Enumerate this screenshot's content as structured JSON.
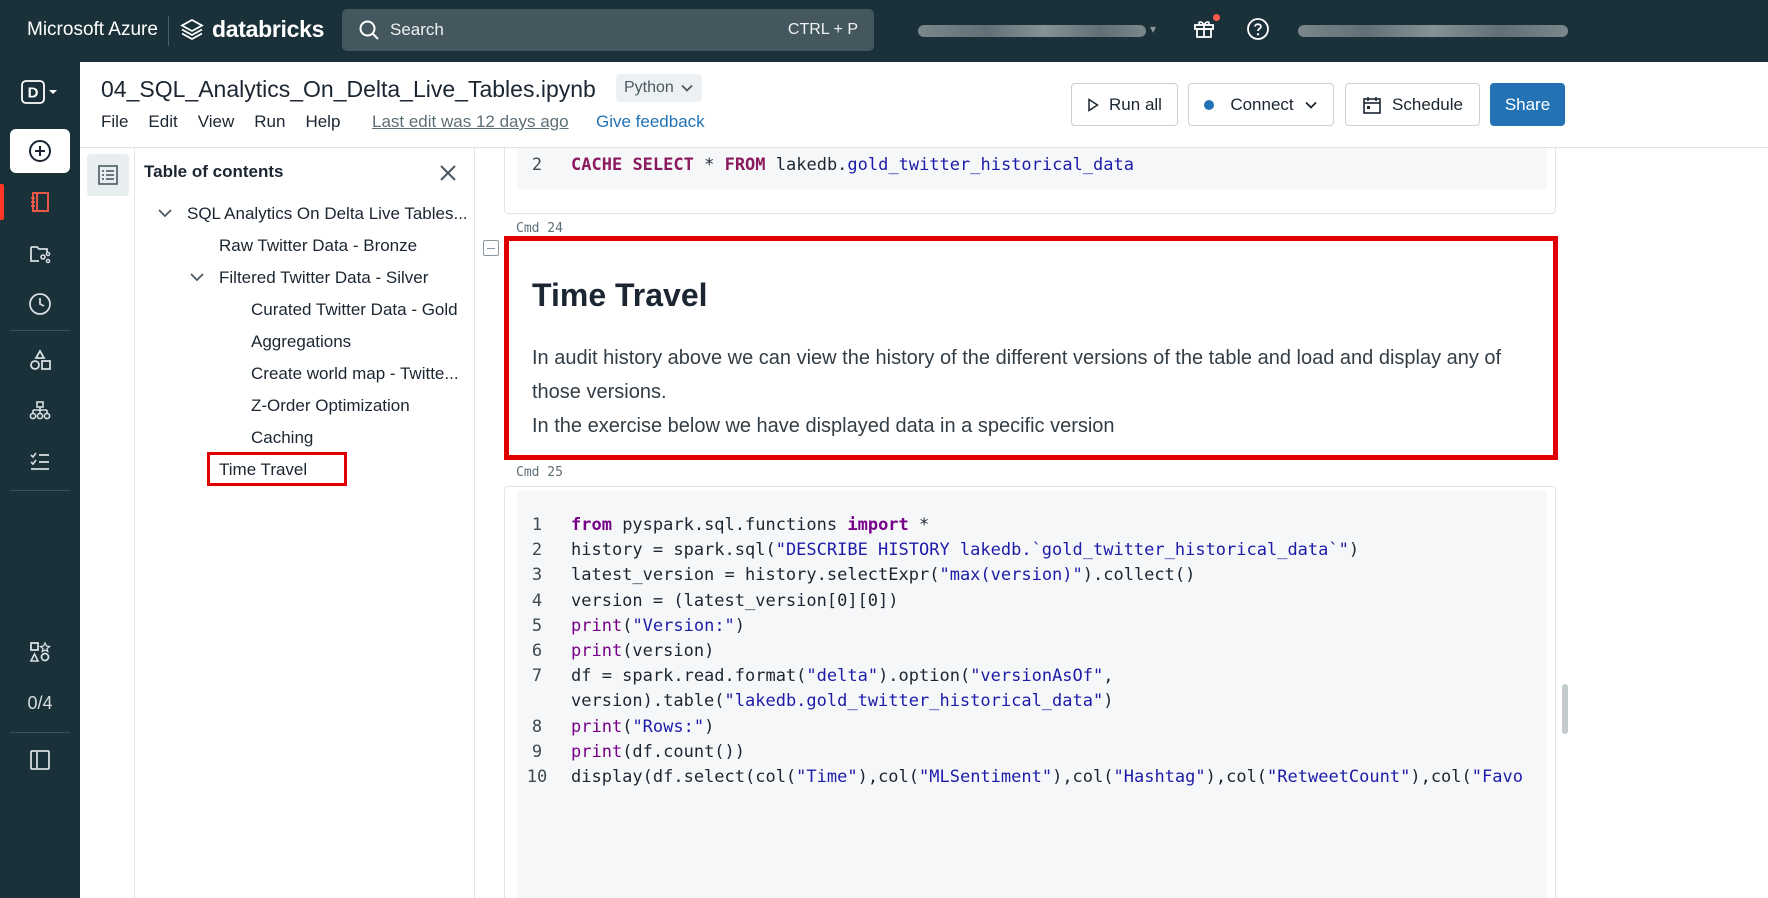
{
  "topbar": {
    "azure_label": "Microsoft Azure",
    "brand_label": "databricks",
    "search_placeholder": "Search",
    "search_shortcut": "CTRL + P"
  },
  "leftnav": {
    "workspace_letter": "D",
    "progress_count": "0/4"
  },
  "notebook": {
    "title": "04_SQL_Analytics_On_Delta_Live_Tables.ipynb",
    "language": "Python",
    "menu": [
      "File",
      "Edit",
      "View",
      "Run",
      "Help"
    ],
    "last_edit": "Last edit was 12 days ago",
    "feedback": "Give feedback",
    "buttons": {
      "run_all": "Run all",
      "connect": "Connect",
      "schedule": "Schedule",
      "share": "Share"
    }
  },
  "toc": {
    "title": "Table of contents",
    "items": [
      {
        "label": "SQL Analytics On Delta Live Tables...",
        "level": 0,
        "expanded": true
      },
      {
        "label": "Raw Twitter Data - Bronze",
        "level": 1
      },
      {
        "label": "Filtered Twitter Data - Silver",
        "level": 1,
        "expanded": true
      },
      {
        "label": "Curated Twitter Data - Gold",
        "level": 2
      },
      {
        "label": "Aggregations",
        "level": 2
      },
      {
        "label": "Create world map - Twitte...",
        "level": 2
      },
      {
        "label": "Z-Order Optimization",
        "level": 2
      },
      {
        "label": "Caching",
        "level": 2
      },
      {
        "label": "Time Travel",
        "level": 1,
        "highlighted": true
      }
    ]
  },
  "cells": {
    "prev": {
      "line_no": "2",
      "code": {
        "kw1": "CACHE",
        "kw2": "SELECT",
        "star": " * ",
        "kw3": "FROM",
        "rest_a": " lakedb.",
        "rest_b": "gold_twitter_historical_data"
      }
    },
    "cmd24": "Cmd 24",
    "markdown": {
      "heading": "Time Travel",
      "para1": "In audit history above we can view the history of the different versions of the table and load and display any of those versions.",
      "para2": "In the exercise below we have displayed data in a specific version"
    },
    "cmd25": "Cmd 25",
    "code_lines": [
      {
        "n": "1"
      },
      {
        "n": "2"
      },
      {
        "n": "3"
      },
      {
        "n": "4"
      },
      {
        "n": "5"
      },
      {
        "n": "6"
      },
      {
        "n": "7"
      },
      {
        "n": ""
      },
      {
        "n": "8"
      },
      {
        "n": "9"
      },
      {
        "n": "10"
      }
    ],
    "code_text": {
      "l1_from": "from",
      "l1_mod": " pyspark.sql.functions ",
      "l1_imp": "import",
      "l1_star": " *",
      "l2_a": "history = spark.sql(",
      "l2_s": "\"DESCRIBE HISTORY lakedb.`gold_twitter_historical_data`\"",
      "l2_b": ")",
      "l3_a": "latest_version = history.selectExpr(",
      "l3_s": "\"max(version)\"",
      "l3_b": ").collect()",
      "l4": "version = (latest_version[0][0])",
      "l5_p": "print",
      "l5_a": "(",
      "l5_s": "\"Version:\"",
      "l5_b": ")",
      "l6_p": "print",
      "l6_a": "(version)",
      "l7_a": "df = spark.read.format(",
      "l7_s1": "\"delta\"",
      "l7_b": ").option(",
      "l7_s2": "\"versionAsOf\"",
      "l7_c": ",",
      "l7w_a": "version).table(",
      "l7w_s": "\"lakedb.gold_twitter_historical_data\"",
      "l7w_b": ")",
      "l8_p": "print",
      "l8_a": "(",
      "l8_s": "\"Rows:\"",
      "l8_b": ")",
      "l9_p": "print",
      "l9_a": "(df.count())",
      "l10_a": "display(df.select(col(",
      "l10_s1": "\"Time\"",
      "l10_b": "),col(",
      "l10_s2": "\"MLSentiment\"",
      "l10_c": "),col(",
      "l10_s3": "\"Hashtag\"",
      "l10_d": "),col(",
      "l10_s4": "\"RetweetCount\"",
      "l10_e": "),col(",
      "l10_s5": "\"Favo"
    }
  },
  "colors": {
    "topbar": "#1b3139",
    "accent": "#2272b4",
    "highlight": "#e00000",
    "active_nav": "#ff3621"
  }
}
